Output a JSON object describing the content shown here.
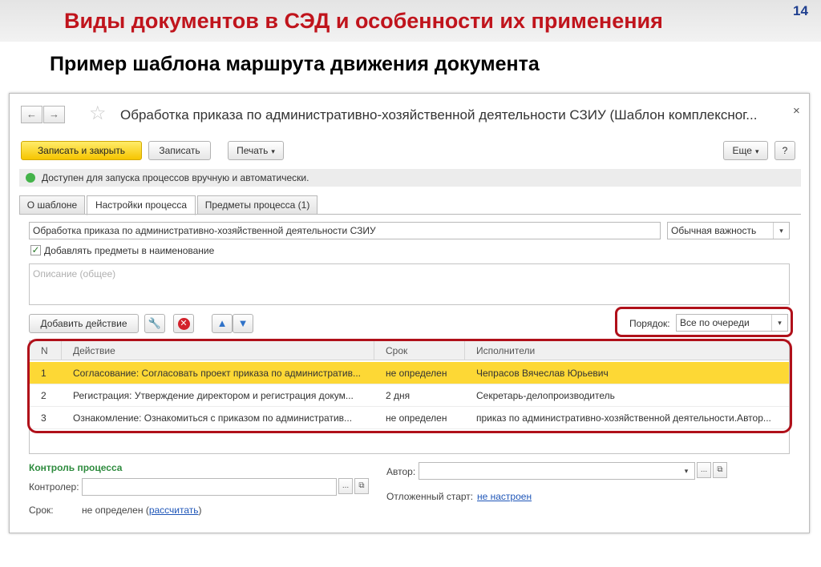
{
  "slide": {
    "title": "Виды документов в СЭД и особенности их применения",
    "number": "14",
    "subtitle": "Пример шаблона маршрута движения документа"
  },
  "window": {
    "title": "Обработка приказа по административно-хозяйственной деятельности СЗИУ (Шаблон комплексног...",
    "back_icon": "←",
    "forward_icon": "→",
    "star_icon": "☆",
    "close_icon": "×"
  },
  "toolbar": {
    "save_close": "Записать и закрыть",
    "save": "Записать",
    "print": "Печать",
    "more": "Еще",
    "help": "?"
  },
  "status": {
    "text": "Доступен для запуска процессов вручную и автоматически."
  },
  "tabs": [
    {
      "label": "О шаблоне"
    },
    {
      "label": "Настройки процесса"
    },
    {
      "label": "Предметы процесса (1)"
    }
  ],
  "form": {
    "name_value": "Обработка приказа по административно-хозяйственной деятельности СЗИУ",
    "importance_value": "Обычная важность",
    "add_subjects_label": "Добавлять предметы в наименование",
    "description_placeholder": "Описание (общее)"
  },
  "actions": {
    "add_action": "Добавить действие",
    "order_label": "Порядок:",
    "order_value": "Все по очереди"
  },
  "table": {
    "headers": {
      "n": "N",
      "action": "Действие",
      "term": "Срок",
      "executors": "Исполнители"
    },
    "rows": [
      {
        "n": "1",
        "action": "Согласование: Согласовать проект приказа по административ...",
        "term": "не определен",
        "executors": "Чепрасов Вячеслав Юрьевич"
      },
      {
        "n": "2",
        "action": "Регистрация: Утверждение директором и регистрация докум...",
        "term": "2 дня",
        "executors": "Секретарь-делопроизводитель"
      },
      {
        "n": "3",
        "action": "Ознакомление: Ознакомиться с приказом по административ...",
        "term": "не определен",
        "executors": "приказ по административно-хозяйственной деятельности.Автор..."
      }
    ]
  },
  "control": {
    "title": "Контроль процесса",
    "controller_label": "Контролер:",
    "term_label": "Срок:",
    "term_value": "не определен",
    "calc_link": "рассчитать",
    "author_label": "Автор:",
    "delayed_start_label": "Отложенный старт:",
    "delayed_start_link": "не настроен"
  },
  "colors": {
    "slide_title": "#c0141c",
    "highlight_frame": "#b0101a",
    "selected_row": "#fdd835",
    "primary_button": "#f6c500",
    "section_title": "#2e8b3e",
    "link": "#1f56b8"
  }
}
